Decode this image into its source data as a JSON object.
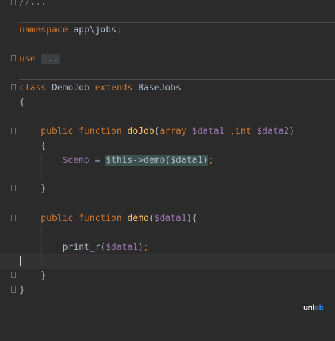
{
  "lines": [
    {
      "segments": [
        {
          "text": "//...",
          "cls": "cmt"
        }
      ]
    },
    {
      "segments": [
        {
          "text": "namespace ",
          "cls": "kw"
        },
        {
          "text": "app\\jobs",
          "cls": "type"
        },
        {
          "text": ";",
          "cls": "kw"
        }
      ]
    },
    {
      "segments": [
        {
          "text": "use ",
          "cls": "kw"
        },
        {
          "text": "...",
          "cls": "dim"
        }
      ]
    },
    {
      "segments": [
        {
          "text": "class ",
          "cls": "kw"
        },
        {
          "text": "DemoJob ",
          "cls": "type"
        },
        {
          "text": "extends ",
          "cls": "kw"
        },
        {
          "text": "BaseJobs",
          "cls": "type"
        }
      ]
    },
    {
      "segments": [
        {
          "text": "{",
          "cls": "type"
        }
      ]
    },
    {
      "segments": [
        {
          "text": "    public function ",
          "cls": "kw"
        },
        {
          "text": "doJob",
          "cls": "fn"
        },
        {
          "text": "(",
          "cls": "type"
        },
        {
          "text": "array ",
          "cls": "kw"
        },
        {
          "text": "$data1 ",
          "cls": "var"
        },
        {
          "text": ",int ",
          "cls": "kw"
        },
        {
          "text": "$data2",
          "cls": "var"
        },
        {
          "text": ")",
          "cls": "type"
        }
      ]
    },
    {
      "segments": [
        {
          "text": "    {",
          "cls": "type"
        }
      ]
    },
    {
      "segments": [
        {
          "text": "        ",
          "cls": "type"
        },
        {
          "text": "$demo",
          "cls": "var"
        },
        {
          "text": " = ",
          "cls": "type"
        },
        {
          "text": "$this",
          "cls": "var hl"
        },
        {
          "text": "->",
          "cls": "type hl"
        },
        {
          "text": "demo",
          "cls": "fn hl"
        },
        {
          "text": "(",
          "cls": "type hl"
        },
        {
          "text": "$data1",
          "cls": "var hl"
        },
        {
          "text": ")",
          "cls": "type hl"
        },
        {
          "text": ";",
          "cls": "kw"
        }
      ]
    },
    {
      "segments": [
        {
          "text": "    }",
          "cls": "type"
        }
      ]
    },
    {
      "segments": [
        {
          "text": "    public function ",
          "cls": "kw"
        },
        {
          "text": "demo",
          "cls": "fn"
        },
        {
          "text": "(",
          "cls": "type"
        },
        {
          "text": "$data1",
          "cls": "var"
        },
        {
          "text": "){",
          "cls": "type"
        }
      ]
    },
    {
      "segments": [
        {
          "text": "        print_r",
          "cls": "type"
        },
        {
          "text": "(",
          "cls": "type"
        },
        {
          "text": "$data1",
          "cls": "var"
        },
        {
          "text": ")",
          "cls": "type"
        },
        {
          "text": ";",
          "cls": "kw"
        }
      ]
    },
    {
      "segments": [
        {
          "text": "    }",
          "cls": "type"
        }
      ]
    },
    {
      "segments": [
        {
          "text": "}",
          "cls": "type"
        }
      ]
    }
  ],
  "watermark": {
    "text": "uni",
    "accent": "ob"
  }
}
